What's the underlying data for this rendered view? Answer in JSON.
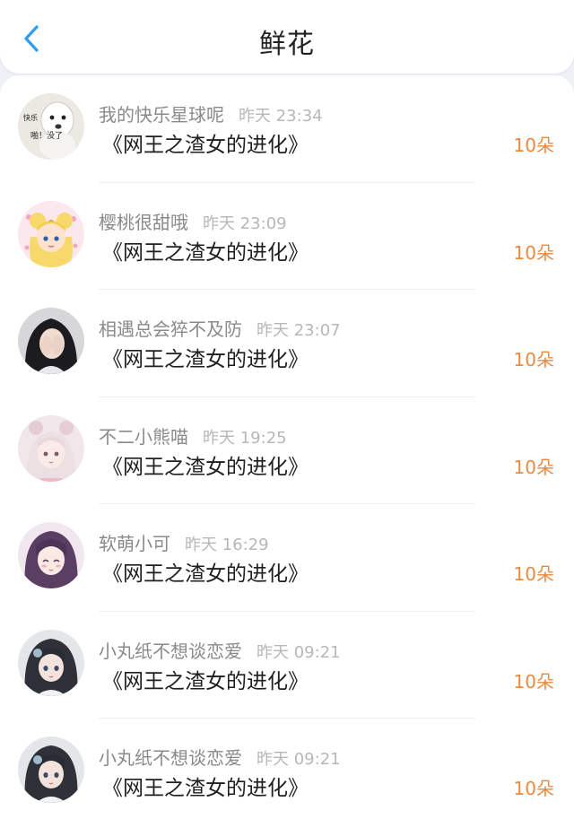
{
  "header": {
    "title": "鲜花",
    "back_icon": "chevron-left-icon",
    "accent_color": "#2d9df0"
  },
  "gifts": [
    {
      "avatar": "dog-meme-avatar",
      "avatar_text": "快乐 啪！没了",
      "username": "我的快乐星球呢",
      "time": "昨天 23:34",
      "book": "《网王之渣女的进化》",
      "amount": "10朵"
    },
    {
      "avatar": "sailor-moon-avatar",
      "username": "樱桃很甜哦",
      "time": "昨天 23:09",
      "book": "《网王之渣女的进化》",
      "amount": "10朵"
    },
    {
      "avatar": "girl-covering-face-avatar",
      "username": "相遇总会猝不及防",
      "time": "昨天 23:07",
      "book": "《网王之渣女的进化》",
      "amount": "10朵"
    },
    {
      "avatar": "pink-bear-girl-avatar",
      "username": "不二小熊喵",
      "time": "昨天 19:25",
      "book": "《网王之渣女的进化》",
      "amount": "10朵"
    },
    {
      "avatar": "purple-hair-anime-girl-avatar",
      "username": "软萌小可",
      "time": "昨天 16:29",
      "book": "《网王之渣女的进化》",
      "amount": "10朵"
    },
    {
      "avatar": "anime-girl-dark-hair-avatar",
      "username": "小丸纸不想谈恋爱",
      "time": "昨天 09:21",
      "book": "《网王之渣女的进化》",
      "amount": "10朵"
    },
    {
      "avatar": "anime-girl-dark-hair-avatar",
      "username": "小丸纸不想谈恋爱",
      "time": "昨天 09:21",
      "book": "《网王之渣女的进化》",
      "amount": "10朵"
    }
  ],
  "colors": {
    "amount": "#e98a40",
    "username": "#8a8a8a",
    "timestamp": "#b7b7b7",
    "book_title": "#1f1f1f"
  }
}
